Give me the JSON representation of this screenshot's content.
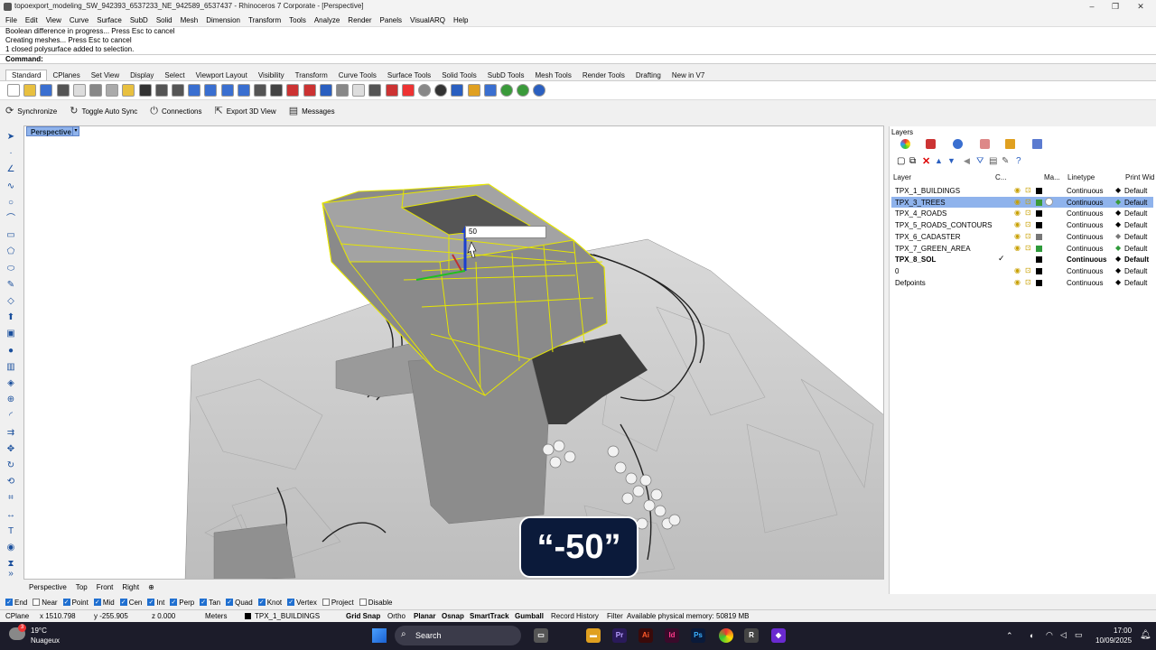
{
  "window": {
    "title": "topoexport_modeling_SW_942393_6537233_NE_942589_6537437 - Rhinoceros 7 Corporate - [Perspective]",
    "controls": [
      "–",
      "❐",
      "✕"
    ]
  },
  "menu": [
    "File",
    "Edit",
    "View",
    "Curve",
    "Surface",
    "SubD",
    "Solid",
    "Mesh",
    "Dimension",
    "Transform",
    "Tools",
    "Analyze",
    "Render",
    "Panels",
    "VisualARQ",
    "Help"
  ],
  "command_history": [
    "Boolean difference in progress... Press Esc to cancel",
    "Creating meshes... Press Esc to cancel",
    "1 closed polysurface added to selection."
  ],
  "command_prompt": "Command:",
  "toolbar_tabs": [
    "Standard",
    "CPlanes",
    "Set View",
    "Display",
    "Select",
    "Viewport Layout",
    "Visibility",
    "Transform",
    "Curve Tools",
    "Surface Tools",
    "Solid Tools",
    "SubD Tools",
    "Mesh Tools",
    "Render Tools",
    "Drafting",
    "New in V7"
  ],
  "sync_bar": {
    "synchronize": "Synchronize",
    "toggle_auto_sync": "Toggle Auto Sync",
    "connections": "Connections",
    "export_3d_view": "Export 3D View",
    "messages": "Messages"
  },
  "viewport": {
    "name": "Perspective",
    "gumball_input": "50",
    "overlay_caption": "“-50”"
  },
  "view_tabs": [
    "Perspective",
    "Top",
    "Front",
    "Right",
    "⊕"
  ],
  "layers_panel": {
    "title": "Layers",
    "columns": {
      "layer": "Layer",
      "current": "C...",
      "material": "Ma...",
      "linetype": "Linetype",
      "print_width": "Print Wid"
    },
    "rows": [
      {
        "name": "TPX_1_BUILDINGS",
        "linetype": "Continuous",
        "print_width": "Default",
        "color": "#000000",
        "selected": false,
        "current": false,
        "bold": false
      },
      {
        "name": "TPX_3_TREES",
        "linetype": "Continuous",
        "print_width": "Default",
        "color": "#3a9a3a",
        "selected": true,
        "current": false,
        "bold": false
      },
      {
        "name": "TPX_4_ROADS",
        "linetype": "Continuous",
        "print_width": "Default",
        "color": "#000000",
        "selected": false,
        "current": false,
        "bold": false
      },
      {
        "name": "TPX_5_ROADS_CONTOURS",
        "linetype": "Continuous",
        "print_width": "Default",
        "color": "#000000",
        "selected": false,
        "current": false,
        "bold": false
      },
      {
        "name": "TPX_6_CADASTER",
        "linetype": "Continuous",
        "print_width": "Default",
        "color": "#777777",
        "selected": false,
        "current": false,
        "bold": false
      },
      {
        "name": "TPX_7_GREEN_AREA",
        "linetype": "Continuous",
        "print_width": "Default",
        "color": "#2e9a3a",
        "selected": false,
        "current": false,
        "bold": false
      },
      {
        "name": "TPX_8_SOL",
        "linetype": "Continuous",
        "print_width": "Default",
        "color": "#000000",
        "selected": false,
        "current": true,
        "bold": true
      },
      {
        "name": "0",
        "linetype": "Continuous",
        "print_width": "Default",
        "color": "#000000",
        "selected": false,
        "current": false,
        "bold": false
      },
      {
        "name": "Defpoints",
        "linetype": "Continuous",
        "print_width": "Default",
        "color": "#000000",
        "selected": false,
        "current": false,
        "bold": false
      }
    ],
    "current_mark": "✓"
  },
  "osnaps": [
    {
      "label": "End",
      "on": true
    },
    {
      "label": "Near",
      "on": false
    },
    {
      "label": "Point",
      "on": true
    },
    {
      "label": "Mid",
      "on": true
    },
    {
      "label": "Cen",
      "on": true
    },
    {
      "label": "Int",
      "on": true
    },
    {
      "label": "Perp",
      "on": true
    },
    {
      "label": "Tan",
      "on": true
    },
    {
      "label": "Quad",
      "on": true
    },
    {
      "label": "Knot",
      "on": true
    },
    {
      "label": "Vertex",
      "on": true
    },
    {
      "label": "Project",
      "on": false
    },
    {
      "label": "Disable",
      "on": false
    }
  ],
  "status": {
    "cplane": "CPlane",
    "x": "x 1510.798",
    "y": "y -255.905",
    "z": "z 0.000",
    "units": "Meters",
    "layer": "TPX_1_BUILDINGS",
    "grid_snap": "Grid Snap",
    "ortho": "Ortho",
    "planar": "Planar",
    "osnap": "Osnap",
    "smarttrack": "SmartTrack",
    "gumball": "Gumball",
    "record_history": "Record History",
    "filter": "Filter",
    "memory": "Available physical memory: 50819 MB"
  },
  "taskbar": {
    "temperature": "19°C",
    "weather": "Nuageux",
    "search_placeholder": "Search",
    "time": "17:00",
    "date": "10/09/2025",
    "badge": "3"
  }
}
